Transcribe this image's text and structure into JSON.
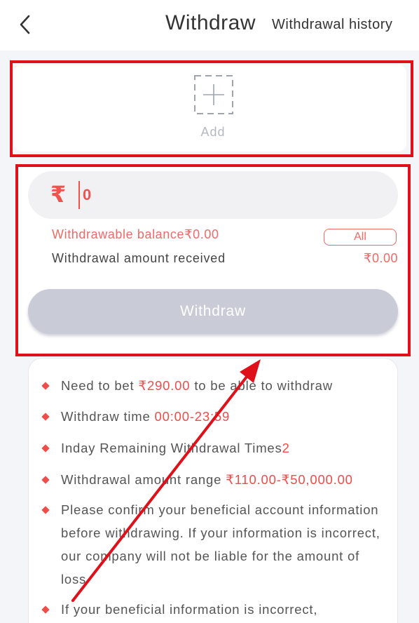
{
  "header": {
    "title": "Withdraw",
    "history_label": "Withdrawal history"
  },
  "add_card": {
    "add_label": "Add"
  },
  "withdraw_card": {
    "currency_symbol": "₹",
    "amount_value": "0",
    "balance_label": "Withdrawable balance",
    "balance_value": "₹0.00",
    "all_label": "All",
    "received_label": "Withdrawal amount received",
    "received_value": "₹0.00",
    "withdraw_button_label": "Withdraw"
  },
  "rules": {
    "r1_pre": "Need to bet ",
    "r1_amount": "₹290.00",
    "r1_post": " to be able to withdraw",
    "r2_pre": "Withdraw time ",
    "r2_time": "00:00-23:59",
    "r3_pre": "Inday Remaining Withdrawal Times",
    "r3_count": "2",
    "r4_pre": "Withdrawal amount range ",
    "r4_range": "₹110.00-₹50,000.00",
    "r5_text": "Please confirm your beneficial account information before withdrawing. If your information is incorrect, our company will not be liable for the amount of loss",
    "r6_text": "If your beneficial information is incorrect,"
  },
  "colors": {
    "accent_red": "#ef4d4a",
    "highlight_box": "#e0101a",
    "button_disabled": "#c9cbd6"
  }
}
